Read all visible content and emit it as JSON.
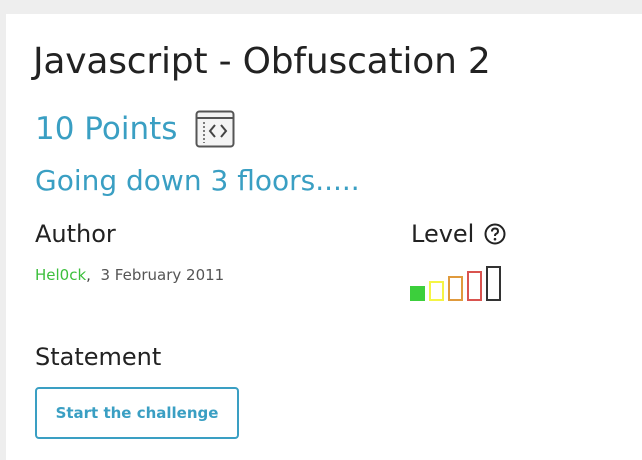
{
  "challenge": {
    "title": "Javascript - Obfuscation 2",
    "points": "10 Points",
    "category_icon": "code-window-icon",
    "subtitle": "Going down 3 floors....."
  },
  "author": {
    "label": "Author",
    "name": "Hel0ck",
    "separator": ",",
    "date": "3 February 2011"
  },
  "level": {
    "label": "Level",
    "help_icon": "question-circle-icon",
    "current": 1,
    "max": 5,
    "colors": [
      "#3ccf3c",
      "#f5f545",
      "#e09a3c",
      "#d9534f",
      "#333333"
    ]
  },
  "statement": {
    "label": "Statement",
    "button_label": "Start the challenge"
  },
  "colors": {
    "accent": "#3a9fc3",
    "author_name": "#3cbf3c"
  }
}
